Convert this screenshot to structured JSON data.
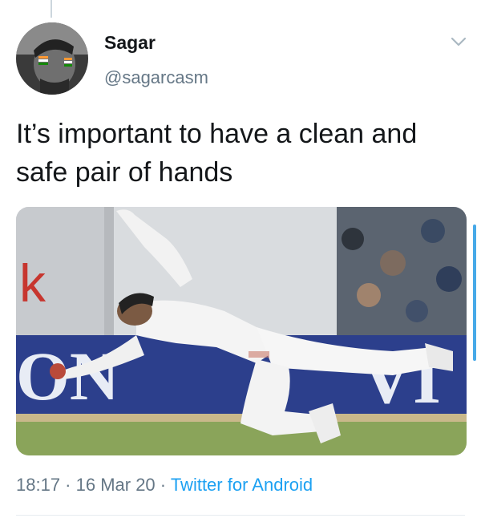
{
  "tweet": {
    "author": {
      "display_name": "Sagar",
      "handle": "@sagarcasm",
      "avatar_icon": "avatar-photo"
    },
    "text": "It’s important to have a clean and safe pair of hands",
    "media": {
      "banner_left_text": "ON",
      "banner_right_text": "VI",
      "wall_letter": "k"
    },
    "timestamp": "18:17 · 16 Mar 20 ·",
    "source": "Twitter for Android"
  },
  "colors": {
    "accent": "#1da1f2",
    "secondary_text": "#657786",
    "banner_blue": "#2c3f8c"
  },
  "icons": {
    "menu": "chevron-down-icon"
  }
}
